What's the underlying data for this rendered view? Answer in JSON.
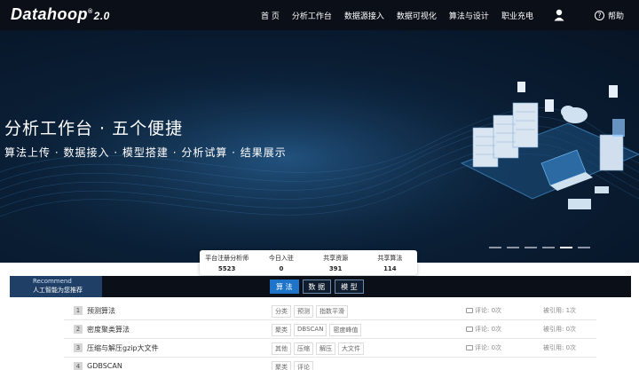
{
  "header": {
    "logo": "Datahoop",
    "logo_mark": "®",
    "version": "2.0",
    "nav": [
      "首 页",
      "分析工作台",
      "数据源接入",
      "数据可视化",
      "算法与设计",
      "职业充电"
    ],
    "help": "帮助"
  },
  "hero": {
    "title": "分析工作台 · 五个便捷",
    "subtitle": "算法上传 · 数据接入 · 模型搭建 · 分析试算 · 结果展示",
    "slide_count": 6,
    "active_slide": 5
  },
  "stats": [
    {
      "label": "平台注册分析师",
      "value": "5523"
    },
    {
      "label": "今日入驻",
      "value": "0"
    },
    {
      "label": "共享资源",
      "value": "391"
    },
    {
      "label": "共享算法",
      "value": "114"
    }
  ],
  "recommend": {
    "en": "Recommend",
    "cn": "人工智能为您推荐",
    "tabs": [
      "算 法",
      "数 据",
      "模 型"
    ],
    "active_tab": 0
  },
  "list": [
    {
      "num": "1",
      "name": "预测算法",
      "tags": [
        "分类",
        "预测",
        "指数平滑"
      ],
      "comment": "评论: 0次",
      "cite": "被引用: 1次"
    },
    {
      "num": "2",
      "name": "密度聚类算法",
      "tags": [
        "聚类",
        "DBSCAN",
        "密度峰值"
      ],
      "comment": "评论: 0次",
      "cite": "被引用: 0次"
    },
    {
      "num": "3",
      "name": "压缩与解压gzip大文件",
      "tags": [
        "其他",
        "压缩",
        "解压",
        "大文件"
      ],
      "comment": "评论: 0次",
      "cite": "被引用: 0次"
    },
    {
      "num": "4",
      "name": "GDBSCAN",
      "tags": [
        "聚类",
        "评论"
      ],
      "comment": "",
      "cite": ""
    }
  ],
  "colors": {
    "accent": "#1e74c9",
    "topbar": "#0b1018",
    "hero": "#0a1f36"
  }
}
